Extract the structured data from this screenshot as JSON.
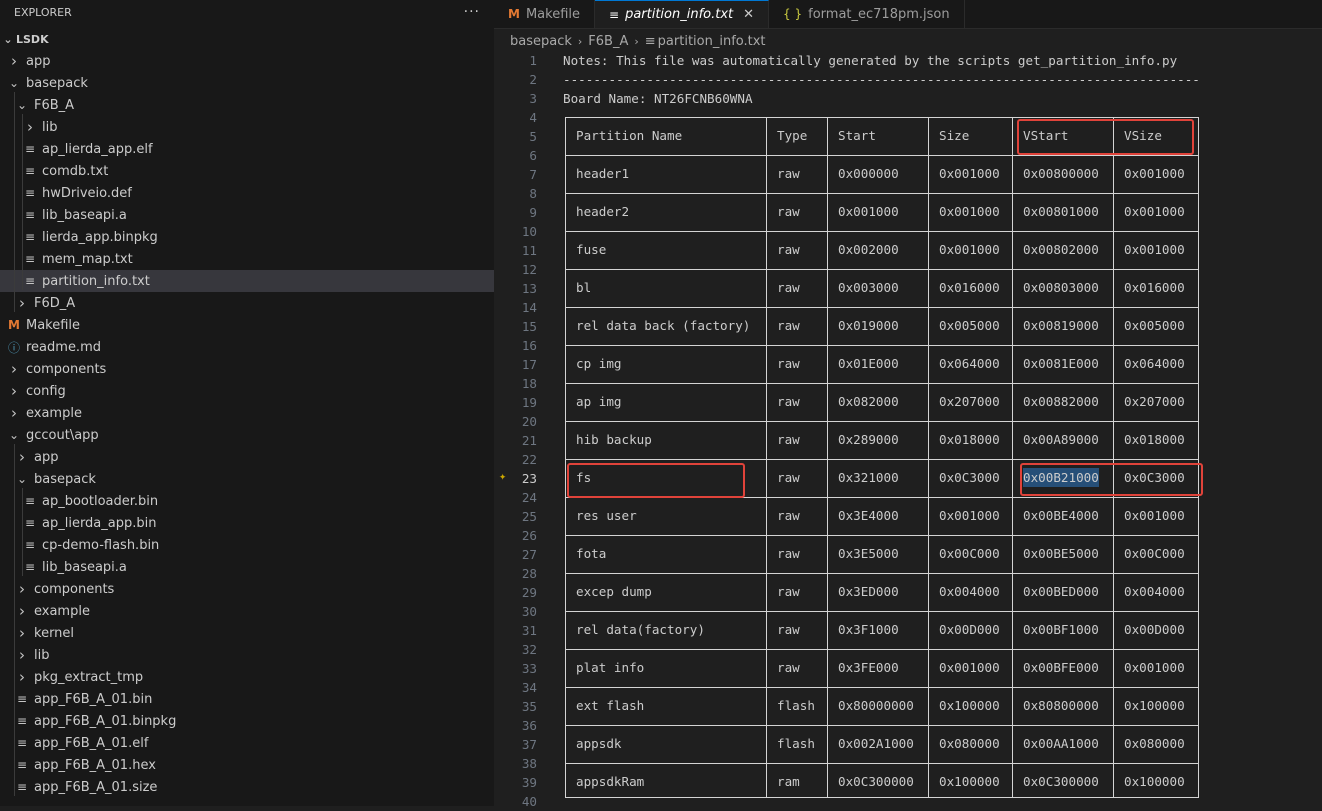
{
  "explorer": {
    "title": "EXPLORER",
    "more": "···",
    "root": "LSDK",
    "items": [
      {
        "label": "app",
        "depth": 1,
        "type": "folder",
        "open": false
      },
      {
        "label": "basepack",
        "depth": 1,
        "type": "folder",
        "open": true
      },
      {
        "label": "F6B_A",
        "depth": 2,
        "type": "folder",
        "open": true
      },
      {
        "label": "lib",
        "depth": 3,
        "type": "folder",
        "open": false
      },
      {
        "label": "ap_lierda_app.elf",
        "depth": 3,
        "type": "file"
      },
      {
        "label": "comdb.txt",
        "depth": 3,
        "type": "file"
      },
      {
        "label": "hwDriveio.def",
        "depth": 3,
        "type": "file"
      },
      {
        "label": "lib_baseapi.a",
        "depth": 3,
        "type": "file"
      },
      {
        "label": "lierda_app.binpkg",
        "depth": 3,
        "type": "file"
      },
      {
        "label": "mem_map.txt",
        "depth": 3,
        "type": "file"
      },
      {
        "label": "partition_info.txt",
        "depth": 3,
        "type": "file",
        "selected": true
      },
      {
        "label": "F6D_A",
        "depth": 2,
        "type": "folder",
        "open": false
      },
      {
        "label": "Makefile",
        "depth": 1,
        "type": "makefile"
      },
      {
        "label": "readme.md",
        "depth": 1,
        "type": "info"
      },
      {
        "label": "components",
        "depth": 1,
        "type": "folder",
        "open": false
      },
      {
        "label": "config",
        "depth": 1,
        "type": "folder",
        "open": false
      },
      {
        "label": "example",
        "depth": 1,
        "type": "folder",
        "open": false
      },
      {
        "label": "gccout\\app",
        "depth": 1,
        "type": "folder",
        "open": true
      },
      {
        "label": "app",
        "depth": 2,
        "type": "folder",
        "open": false
      },
      {
        "label": "basepack",
        "depth": 2,
        "type": "folder",
        "open": true
      },
      {
        "label": "ap_bootloader.bin",
        "depth": 3,
        "type": "file"
      },
      {
        "label": "ap_lierda_app.bin",
        "depth": 3,
        "type": "file"
      },
      {
        "label": "cp-demo-flash.bin",
        "depth": 3,
        "type": "file"
      },
      {
        "label": "lib_baseapi.a",
        "depth": 3,
        "type": "file"
      },
      {
        "label": "components",
        "depth": 2,
        "type": "folder",
        "open": false
      },
      {
        "label": "example",
        "depth": 2,
        "type": "folder",
        "open": false
      },
      {
        "label": "kernel",
        "depth": 2,
        "type": "folder",
        "open": false
      },
      {
        "label": "lib",
        "depth": 2,
        "type": "folder",
        "open": false
      },
      {
        "label": "pkg_extract_tmp",
        "depth": 2,
        "type": "folder",
        "open": false
      },
      {
        "label": "app_F6B_A_01.bin",
        "depth": 2,
        "type": "file"
      },
      {
        "label": "app_F6B_A_01.binpkg",
        "depth": 2,
        "type": "file"
      },
      {
        "label": "app_F6B_A_01.elf",
        "depth": 2,
        "type": "file"
      },
      {
        "label": "app_F6B_A_01.hex",
        "depth": 2,
        "type": "file"
      },
      {
        "label": "app_F6B_A_01.size",
        "depth": 2,
        "type": "file"
      }
    ]
  },
  "tabs": [
    {
      "label": "Makefile",
      "icon": "makefile-icon",
      "active": false
    },
    {
      "label": "partition_info.txt",
      "icon": "text-file-icon",
      "active": true
    },
    {
      "label": "format_ec718pm.json",
      "icon": "json-icon",
      "active": false
    }
  ],
  "breadcrumb": [
    "basepack",
    "F6B_A",
    "partition_info.txt"
  ],
  "file": {
    "notes": "Notes: This file was automatically generated by the scripts get_partition_info.py",
    "divider": "------------------------------------------------------------------------------------",
    "board": "Board Name: NT26FCNB60WNA",
    "headers": [
      "Partition Name",
      "Type",
      "Start",
      "Size",
      "VStart",
      "VSize"
    ],
    "rows": [
      [
        "header1",
        "raw",
        "0x000000",
        "0x001000",
        "0x00800000",
        "0x001000"
      ],
      [
        "header2",
        "raw",
        "0x001000",
        "0x001000",
        "0x00801000",
        "0x001000"
      ],
      [
        "fuse",
        "raw",
        "0x002000",
        "0x001000",
        "0x00802000",
        "0x001000"
      ],
      [
        "bl",
        "raw",
        "0x003000",
        "0x016000",
        "0x00803000",
        "0x016000"
      ],
      [
        "rel data back (factory)",
        "raw",
        "0x019000",
        "0x005000",
        "0x00819000",
        "0x005000"
      ],
      [
        "cp img",
        "raw",
        "0x01E000",
        "0x064000",
        "0x0081E000",
        "0x064000"
      ],
      [
        "ap img",
        "raw",
        "0x082000",
        "0x207000",
        "0x00882000",
        "0x207000"
      ],
      [
        "hib backup",
        "raw",
        "0x289000",
        "0x018000",
        "0x00A89000",
        "0x018000"
      ],
      [
        "fs",
        "raw",
        "0x321000",
        "0x0C3000",
        "0x00B21000",
        "0x0C3000"
      ],
      [
        "res user",
        "raw",
        "0x3E4000",
        "0x001000",
        "0x00BE4000",
        "0x001000"
      ],
      [
        "fota",
        "raw",
        "0x3E5000",
        "0x00C000",
        "0x00BE5000",
        "0x00C000"
      ],
      [
        "excep dump",
        "raw",
        "0x3ED000",
        "0x004000",
        "0x00BED000",
        "0x004000"
      ],
      [
        "rel data(factory)",
        "raw",
        "0x3F1000",
        "0x00D000",
        "0x00BF1000",
        "0x00D000"
      ],
      [
        "plat info",
        "raw",
        "0x3FE000",
        "0x001000",
        "0x00BFE000",
        "0x001000"
      ],
      [
        "ext flash",
        "flash",
        "0x80000000",
        "0x100000",
        "0x80800000",
        "0x100000"
      ],
      [
        "appsdk",
        "flash",
        "0x002A1000",
        "0x080000",
        "0x00AA1000",
        "0x080000"
      ],
      [
        "appsdkRam",
        "ram",
        "0x0C300000",
        "0x100000",
        "0x0C300000",
        "0x100000"
      ]
    ],
    "current_line": 23
  },
  "colors": {
    "highlight_box": "#e0433a",
    "selection": "#264f78",
    "accent": "#0078d4"
  }
}
